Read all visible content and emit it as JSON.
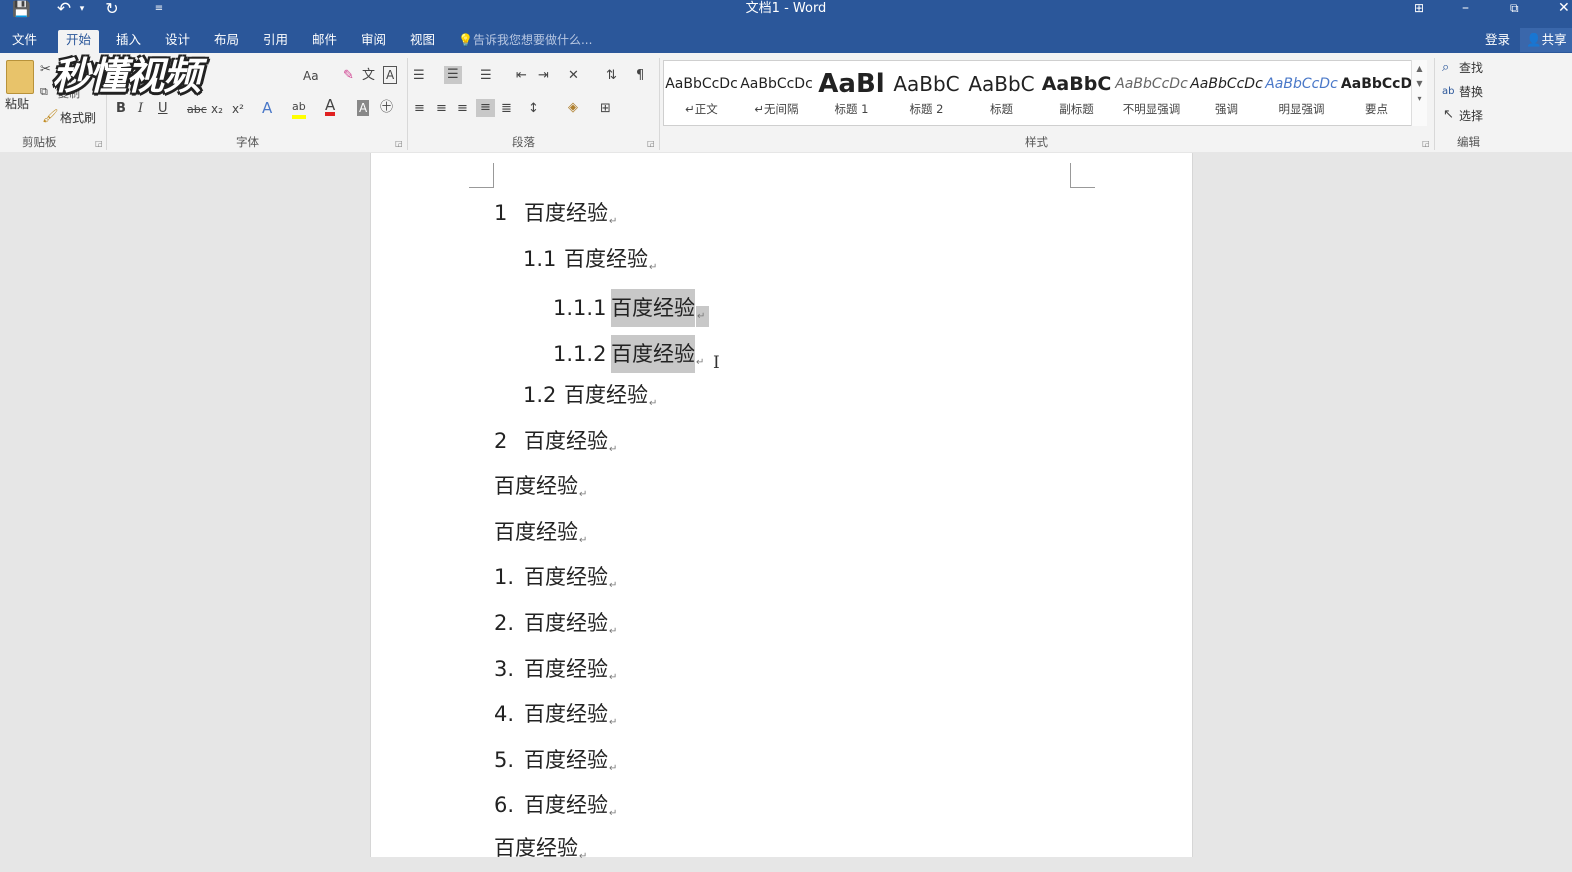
{
  "window": {
    "title": "文档1 - Word",
    "minimize": "–",
    "restore": "⧉",
    "close": "✕",
    "ribbon_display": "⊞"
  },
  "quick_access": {
    "save": "💾",
    "undo": "↶",
    "undo_dropdown": "▾",
    "redo": "↻",
    "customize": "≡"
  },
  "tabs": [
    "文件",
    "开始",
    "插入",
    "设计",
    "布局",
    "引用",
    "邮件",
    "审阅",
    "视图"
  ],
  "active_tab": "开始",
  "tell_me": "告诉我您想要做什么...",
  "account": {
    "login": "登录",
    "share": "共享"
  },
  "watermark": "秒懂视频",
  "ribbon": {
    "clipboard": {
      "label": "剪贴板",
      "paste": "粘贴",
      "format_painter": "格式刷",
      "copy": "复制"
    },
    "font": {
      "label": "字体",
      "case": "Aa",
      "bold": "B",
      "italic": "I",
      "underline": "U",
      "strike": "abc",
      "sub": "x₂",
      "sup": "x²"
    },
    "paragraph": {
      "label": "段落"
    },
    "styles": {
      "label": "样式",
      "items": [
        {
          "sample": "AaBbCcDc",
          "name": "↵正文"
        },
        {
          "sample": "AaBbCcDc",
          "name": "↵无间隔"
        },
        {
          "sample": "AaBl",
          "name": "标题 1"
        },
        {
          "sample": "AaBbC",
          "name": "标题 2"
        },
        {
          "sample": "AaBbC",
          "name": "标题"
        },
        {
          "sample": "AaBbC",
          "name": "副标题"
        },
        {
          "sample": "AaBbCcDc",
          "name": "不明显强调"
        },
        {
          "sample": "AaBbCcDc",
          "name": "强调"
        },
        {
          "sample": "AaBbCcDc",
          "name": "明显强调"
        },
        {
          "sample": "AaBbCcD",
          "name": "要点"
        }
      ]
    },
    "editing": {
      "label": "编辑",
      "find": "查找",
      "replace": "替换",
      "select": "选择"
    }
  },
  "document": {
    "lines": [
      {
        "num": "1",
        "text": "百度经验"
      },
      {
        "num": "1.1",
        "text": "百度经验"
      },
      {
        "num": "1.1.1",
        "text": "百度经验"
      },
      {
        "num": "1.1.2",
        "text": "百度经验"
      },
      {
        "num": "1.2",
        "text": "百度经验"
      },
      {
        "num": "2",
        "text": "百度经验"
      },
      {
        "num": "",
        "text": "百度经验"
      },
      {
        "num": "",
        "text": "百度经验"
      },
      {
        "num": "1.",
        "text": "百度经验"
      },
      {
        "num": "2.",
        "text": "百度经验"
      },
      {
        "num": "3.",
        "text": "百度经验"
      },
      {
        "num": "4.",
        "text": "百度经验"
      },
      {
        "num": "5.",
        "text": "百度经验"
      },
      {
        "num": "6.",
        "text": "百度经验"
      },
      {
        "num": "",
        "text": "百度经验"
      }
    ],
    "paragraph_mark": "↵"
  },
  "colors": {
    "accent": "#2b579a",
    "selection": "#c8c8c8",
    "highlight_yellow": "#ffff00",
    "font_red": "#e02020"
  }
}
